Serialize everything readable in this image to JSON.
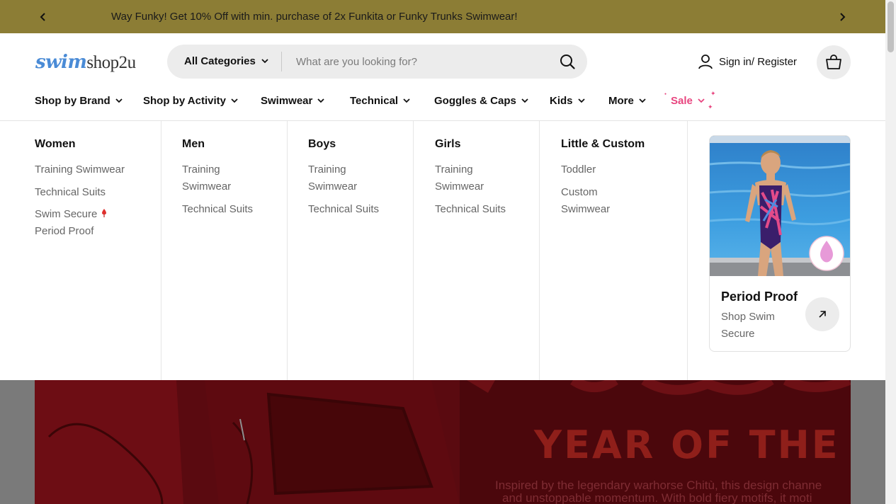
{
  "announcement": {
    "message": "Way Funky! Get 10% Off with min. purchase of 2x Funkita or Funky Trunks Swimwear!"
  },
  "header": {
    "logo_part1": "swim",
    "logo_part2": "shop2u",
    "search": {
      "category_label": "All Categories",
      "placeholder": "What are you looking for?",
      "value": ""
    },
    "signin_label": "Sign in/ Register"
  },
  "nav": {
    "items": [
      {
        "label": "Shop by Brand"
      },
      {
        "label": "Shop by Activity"
      },
      {
        "label": "Swimwear"
      },
      {
        "label": "Technical"
      },
      {
        "label": "Goggles & Caps"
      },
      {
        "label": "Kids"
      },
      {
        "label": "More"
      },
      {
        "label": "Sale"
      }
    ]
  },
  "mega_menu": {
    "columns": [
      {
        "heading": "Women",
        "links": [
          "Training Swimwear",
          "Technical Suits",
          "Swim Secure",
          "Period Proof"
        ]
      },
      {
        "heading": "Men",
        "links": [
          "Training",
          "Swimwear",
          "Technical Suits"
        ]
      },
      {
        "heading": "Boys",
        "links": [
          "Training",
          "Swimwear",
          "Technical Suits"
        ]
      },
      {
        "heading": "Girls",
        "links": [
          "Training",
          "Swimwear",
          "Technical Suits"
        ]
      },
      {
        "heading": "Little & Custom",
        "links": [
          "Toddler",
          "Custom",
          "Swimwear"
        ]
      }
    ],
    "promo_card": {
      "title": "Period Proof",
      "subtitle": "Shop Swim Secure"
    }
  },
  "banner": {
    "title": "YEAR OF THE HO",
    "desc_line1": "Inspired by the legendary warhorse Chitù, this design channe",
    "desc_line2": "and unstoppable momentum. With bold fiery motifs, it moti"
  },
  "colors": {
    "announcement_bg": "#8c7d35",
    "sale_accent": "#e8457f",
    "logo_blue": "#4a8bd6",
    "banner_bg": "#4b070c"
  }
}
